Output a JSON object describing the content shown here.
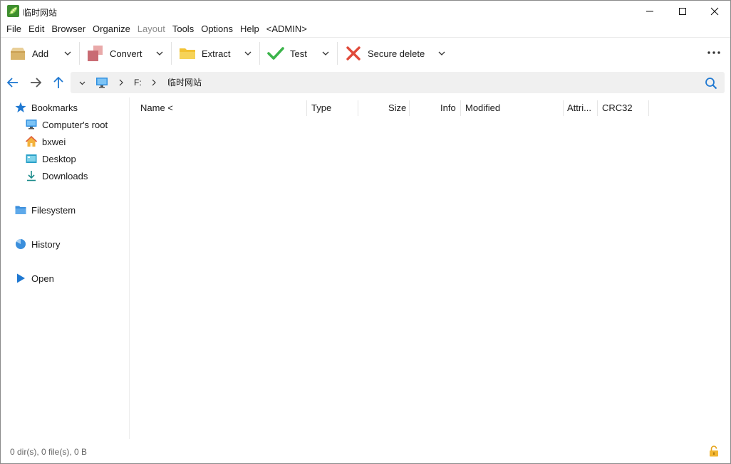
{
  "window": {
    "title": "临时网站",
    "app_icon": "peazip-pea-icon",
    "controls": [
      "minimize-icon",
      "maximize-icon",
      "close-icon"
    ]
  },
  "menu": {
    "items": [
      {
        "label": "File",
        "enabled": true
      },
      {
        "label": "Edit",
        "enabled": true
      },
      {
        "label": "Browser",
        "enabled": true
      },
      {
        "label": "Organize",
        "enabled": true
      },
      {
        "label": "Layout",
        "enabled": false
      },
      {
        "label": "Tools",
        "enabled": true
      },
      {
        "label": "Options",
        "enabled": true
      },
      {
        "label": "Help",
        "enabled": true
      },
      {
        "label": "<ADMIN>",
        "enabled": true
      }
    ]
  },
  "toolbar": {
    "add_label": "Add",
    "convert_label": "Convert",
    "extract_label": "Extract",
    "test_label": "Test",
    "secure_delete_label": "Secure delete",
    "more_icon": "more-horizontal-icon"
  },
  "navigation": {
    "path": {
      "root_icon": "computer-icon",
      "drive": "F:",
      "folder": "临时网站"
    },
    "buttons": [
      "back-arrow-icon",
      "forward-arrow-icon",
      "up-arrow-icon"
    ],
    "search_icon": "search-icon"
  },
  "sidebar": {
    "bookmarks_label": "Bookmarks",
    "bookmark_items": [
      {
        "label": "Computer's root",
        "icon": "computer-icon"
      },
      {
        "label": "bxwei",
        "icon": "home-icon"
      },
      {
        "label": "Desktop",
        "icon": "desktop-icon"
      },
      {
        "label": "Downloads",
        "icon": "download-icon"
      }
    ],
    "filesystem_label": "Filesystem",
    "history_label": "History",
    "open_label": "Open"
  },
  "file_list": {
    "columns": [
      "Name <",
      "Type",
      "Size",
      "Info",
      "Modified",
      "Attri...",
      "CRC32"
    ],
    "rows": []
  },
  "status": {
    "summary": "0 dir(s), 0 file(s), 0 B",
    "lock_icon": "unlocked-padlock-icon"
  },
  "colors": {
    "accent_blue": "#1f78d1",
    "folder_yellow": "#f2c233",
    "test_green": "#3cb44b",
    "delete_red": "#e04a3a"
  }
}
